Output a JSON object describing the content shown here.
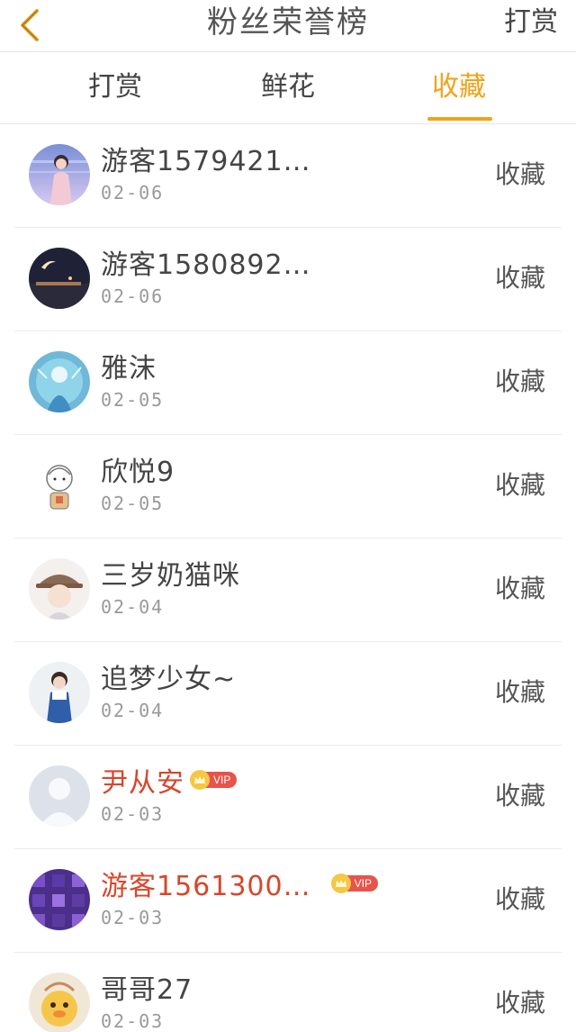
{
  "header": {
    "title": "粉丝荣誉榜",
    "right_link": "打赏",
    "back_icon": "chevron-left-icon"
  },
  "tabs": [
    {
      "label": "打赏",
      "active": false
    },
    {
      "label": "鲜花",
      "active": false
    },
    {
      "label": "收藏",
      "active": true
    }
  ],
  "colors": {
    "accent": "#f0a319",
    "vip_name": "#d9452b",
    "vip_badge": "#e8534a"
  },
  "list": [
    {
      "name": "游客1579421…",
      "date": "02-06",
      "action": "收藏",
      "vip": false,
      "vip_label": ""
    },
    {
      "name": "游客1580892…",
      "date": "02-06",
      "action": "收藏",
      "vip": false,
      "vip_label": ""
    },
    {
      "name": "雅沫",
      "date": "02-05",
      "action": "收藏",
      "vip": false,
      "vip_label": ""
    },
    {
      "name": "欣悦9",
      "date": "02-05",
      "action": "收藏",
      "vip": false,
      "vip_label": ""
    },
    {
      "name": "三岁奶猫咪",
      "date": "02-04",
      "action": "收藏",
      "vip": false,
      "vip_label": ""
    },
    {
      "name": "追梦少女~",
      "date": "02-04",
      "action": "收藏",
      "vip": false,
      "vip_label": ""
    },
    {
      "name": "尹从安",
      "date": "02-03",
      "action": "收藏",
      "vip": true,
      "vip_label": "VIP"
    },
    {
      "name": "游客1561300…",
      "date": "02-03",
      "action": "收藏",
      "vip": true,
      "vip_label": "VIP"
    },
    {
      "name": "哥哥27",
      "date": "02-03",
      "action": "收藏",
      "vip": false,
      "vip_label": ""
    }
  ]
}
